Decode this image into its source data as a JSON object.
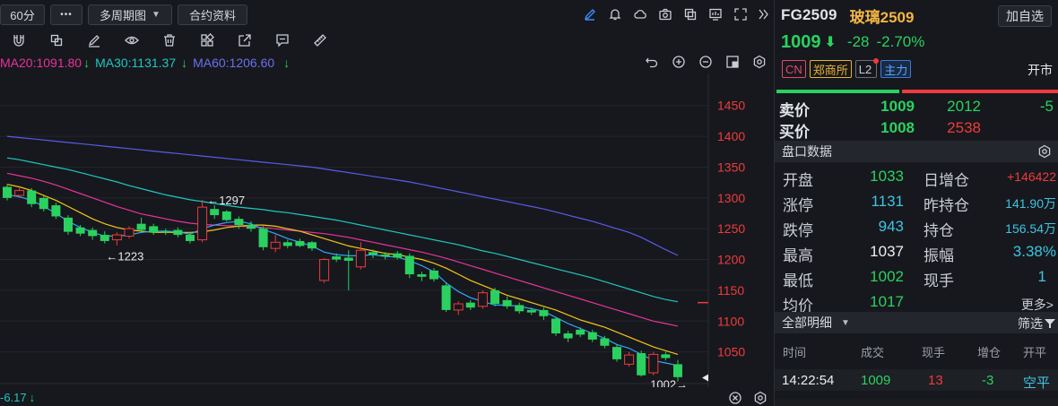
{
  "toolbar": {
    "period": "60分",
    "more_label": "•••",
    "multi_period": "多周期图",
    "contract_info": "合约资料",
    "right_icons": [
      "pen-icon",
      "bell-icon",
      "cloud-icon",
      "camera-icon",
      "copy-icon",
      "monitor-icon",
      "fullscreen-icon",
      "double-chevron-right-icon"
    ]
  },
  "drawing_tools": [
    "magnet-icon",
    "layers-icon",
    "pencil-icon",
    "eye-icon",
    "trash-icon",
    "grid-add-icon",
    "share-icon",
    "comment-icon",
    "ruler-icon"
  ],
  "ma": {
    "ma20": "MA20:1091.80",
    "ma30": "MA30:1131.37",
    "ma60": "MA60:1206.60",
    "arrow": "↓",
    "colors": {
      "ma5": "#2ea8ff",
      "ma10": "#f5c518",
      "ma20": "#e8339a",
      "ma30": "#1fc7c0",
      "ma60": "#5a5be8"
    }
  },
  "chart_controls": [
    "undo-icon",
    "zoom-in-icon",
    "zoom-out-icon",
    "layout-icon",
    "settings-icon"
  ],
  "chart_data": {
    "type": "candlestick",
    "y_ticks": [
      "1450",
      "1400",
      "1350",
      "1300",
      "1250",
      "1200",
      "1150",
      "1100",
      "1050"
    ],
    "ylim": [
      1002,
      1480
    ],
    "annotations": [
      {
        "text": "←1297",
        "x_index": 17,
        "price": 1297
      },
      {
        "text": "←1223",
        "x_index": 9,
        "price": 1223
      },
      {
        "text": "1002→",
        "x_index": 57,
        "price": 1002
      }
    ],
    "candles": [
      {
        "o": 1318,
        "c": 1300,
        "h": 1322,
        "l": 1296
      },
      {
        "o": 1304,
        "c": 1312,
        "h": 1316,
        "l": 1300
      },
      {
        "o": 1312,
        "c": 1290,
        "h": 1316,
        "l": 1285
      },
      {
        "o": 1300,
        "c": 1282,
        "h": 1304,
        "l": 1278
      },
      {
        "o": 1288,
        "c": 1270,
        "h": 1292,
        "l": 1266
      },
      {
        "o": 1268,
        "c": 1245,
        "h": 1272,
        "l": 1240
      },
      {
        "o": 1252,
        "c": 1242,
        "h": 1256,
        "l": 1238
      },
      {
        "o": 1248,
        "c": 1238,
        "h": 1252,
        "l": 1232
      },
      {
        "o": 1240,
        "c": 1230,
        "h": 1246,
        "l": 1226
      },
      {
        "o": 1232,
        "c": 1240,
        "h": 1244,
        "l": 1223
      },
      {
        "o": 1238,
        "c": 1250,
        "h": 1254,
        "l": 1234
      },
      {
        "o": 1258,
        "c": 1248,
        "h": 1268,
        "l": 1244
      },
      {
        "o": 1254,
        "c": 1244,
        "h": 1258,
        "l": 1240
      },
      {
        "o": 1246,
        "c": 1244,
        "h": 1250,
        "l": 1240
      },
      {
        "o": 1248,
        "c": 1240,
        "h": 1252,
        "l": 1236
      },
      {
        "o": 1240,
        "c": 1230,
        "h": 1244,
        "l": 1226
      },
      {
        "o": 1232,
        "c": 1285,
        "h": 1297,
        "l": 1228
      },
      {
        "o": 1282,
        "c": 1272,
        "h": 1288,
        "l": 1266
      },
      {
        "o": 1278,
        "c": 1264,
        "h": 1280,
        "l": 1262
      },
      {
        "o": 1266,
        "c": 1256,
        "h": 1270,
        "l": 1250
      },
      {
        "o": 1256,
        "c": 1250,
        "h": 1262,
        "l": 1245
      },
      {
        "o": 1250,
        "c": 1220,
        "h": 1254,
        "l": 1215
      },
      {
        "o": 1218,
        "c": 1228,
        "h": 1240,
        "l": 1212
      },
      {
        "o": 1228,
        "c": 1222,
        "h": 1232,
        "l": 1218
      },
      {
        "o": 1230,
        "c": 1222,
        "h": 1234,
        "l": 1220
      },
      {
        "o": 1228,
        "c": 1218,
        "h": 1230,
        "l": 1214
      },
      {
        "o": 1166,
        "c": 1200,
        "h": 1202,
        "l": 1162
      },
      {
        "o": 1205,
        "c": 1200,
        "h": 1210,
        "l": 1196
      },
      {
        "o": 1203,
        "c": 1198,
        "h": 1215,
        "l": 1150
      },
      {
        "o": 1188,
        "c": 1215,
        "h": 1228,
        "l": 1184
      },
      {
        "o": 1212,
        "c": 1208,
        "h": 1216,
        "l": 1202
      },
      {
        "o": 1208,
        "c": 1205,
        "h": 1212,
        "l": 1200
      },
      {
        "o": 1210,
        "c": 1203,
        "h": 1214,
        "l": 1200
      },
      {
        "o": 1206,
        "c": 1176,
        "h": 1210,
        "l": 1170
      },
      {
        "o": 1176,
        "c": 1172,
        "h": 1180,
        "l": 1165
      },
      {
        "o": 1182,
        "c": 1168,
        "h": 1186,
        "l": 1164
      },
      {
        "o": 1158,
        "c": 1118,
        "h": 1162,
        "l": 1115
      },
      {
        "o": 1118,
        "c": 1128,
        "h": 1132,
        "l": 1110
      },
      {
        "o": 1130,
        "c": 1122,
        "h": 1134,
        "l": 1118
      },
      {
        "o": 1124,
        "c": 1146,
        "h": 1150,
        "l": 1120
      },
      {
        "o": 1150,
        "c": 1128,
        "h": 1154,
        "l": 1124
      },
      {
        "o": 1134,
        "c": 1124,
        "h": 1140,
        "l": 1120
      },
      {
        "o": 1126,
        "c": 1116,
        "h": 1130,
        "l": 1112
      },
      {
        "o": 1118,
        "c": 1114,
        "h": 1122,
        "l": 1110
      },
      {
        "o": 1118,
        "c": 1108,
        "h": 1122,
        "l": 1102
      },
      {
        "o": 1104,
        "c": 1080,
        "h": 1106,
        "l": 1076
      },
      {
        "o": 1080,
        "c": 1072,
        "h": 1084,
        "l": 1066
      },
      {
        "o": 1086,
        "c": 1078,
        "h": 1090,
        "l": 1074
      },
      {
        "o": 1082,
        "c": 1070,
        "h": 1086,
        "l": 1066
      },
      {
        "o": 1072,
        "c": 1060,
        "h": 1076,
        "l": 1056
      },
      {
        "o": 1058,
        "c": 1038,
        "h": 1062,
        "l": 1034
      },
      {
        "o": 1030,
        "c": 1045,
        "h": 1050,
        "l": 1026
      },
      {
        "o": 1048,
        "c": 1012,
        "h": 1052,
        "l": 1010
      },
      {
        "o": 1016,
        "c": 1046,
        "h": 1050,
        "l": 1012
      },
      {
        "o": 1046,
        "c": 1040,
        "h": 1050,
        "l": 1036
      },
      {
        "o": 1030,
        "c": 1009,
        "h": 1037,
        "l": 1002
      }
    ],
    "ma5": [
      1305,
      1302,
      1296,
      1286,
      1275,
      1262,
      1252,
      1244,
      1238,
      1238,
      1240,
      1244,
      1246,
      1246,
      1245,
      1241,
      1250,
      1256,
      1260,
      1262,
      1258,
      1249,
      1242,
      1234,
      1228,
      1222,
      1212,
      1208,
      1206,
      1206,
      1208,
      1205,
      1204,
      1198,
      1190,
      1180,
      1162,
      1148,
      1138,
      1132,
      1126,
      1126,
      1124,
      1120,
      1116,
      1106,
      1096,
      1088,
      1080,
      1072,
      1062,
      1056,
      1046,
      1036,
      1032,
      1028
    ],
    "ma10": [
      1322,
      1318,
      1312,
      1304,
      1296,
      1286,
      1276,
      1266,
      1258,
      1252,
      1248,
      1246,
      1244,
      1244,
      1244,
      1244,
      1245,
      1248,
      1252,
      1254,
      1256,
      1256,
      1254,
      1250,
      1246,
      1240,
      1234,
      1228,
      1222,
      1218,
      1214,
      1210,
      1208,
      1204,
      1200,
      1194,
      1186,
      1176,
      1166,
      1158,
      1150,
      1142,
      1136,
      1130,
      1124,
      1118,
      1110,
      1102,
      1096,
      1090,
      1082,
      1074,
      1066,
      1058,
      1052,
      1046
    ],
    "ma20": [
      1340,
      1336,
      1332,
      1327,
      1321,
      1314,
      1307,
      1300,
      1293,
      1286,
      1280,
      1274,
      1270,
      1266,
      1262,
      1259,
      1257,
      1256,
      1255,
      1254,
      1253,
      1252,
      1250,
      1248,
      1246,
      1244,
      1242,
      1239,
      1236,
      1232,
      1228,
      1224,
      1220,
      1216,
      1212,
      1207,
      1202,
      1196,
      1190,
      1184,
      1178,
      1172,
      1166,
      1160,
      1154,
      1148,
      1142,
      1136,
      1130,
      1124,
      1118,
      1112,
      1106,
      1100,
      1096,
      1091.8
    ],
    "ma30": [
      1365,
      1362,
      1358,
      1354,
      1350,
      1346,
      1341,
      1336,
      1331,
      1326,
      1320,
      1315,
      1310,
      1305,
      1301,
      1297,
      1294,
      1291,
      1288,
      1285,
      1283,
      1281,
      1278,
      1276,
      1273,
      1270,
      1267,
      1264,
      1260,
      1256,
      1252,
      1248,
      1244,
      1240,
      1236,
      1232,
      1228,
      1224,
      1219,
      1214,
      1210,
      1205,
      1200,
      1195,
      1190,
      1185,
      1180,
      1175,
      1170,
      1164,
      1158,
      1152,
      1146,
      1140,
      1135,
      1131.37
    ],
    "ma60": [
      1400,
      1398,
      1396,
      1394,
      1392,
      1390,
      1388,
      1386,
      1384,
      1382,
      1380,
      1378,
      1376,
      1374,
      1372,
      1370,
      1368,
      1366,
      1364,
      1362,
      1360,
      1358,
      1356,
      1354,
      1352,
      1350,
      1347,
      1344,
      1341,
      1338,
      1335,
      1332,
      1329,
      1326,
      1322,
      1318,
      1314,
      1310,
      1306,
      1302,
      1298,
      1294,
      1290,
      1286,
      1282,
      1277,
      1272,
      1267,
      1262,
      1256,
      1250,
      1244,
      1236,
      1226,
      1216,
      1206.6
    ],
    "last_marker_price": 1130,
    "colors": {
      "up": "#ef3b3b",
      "down": "#2bd15f",
      "axis": "#ef3b3b",
      "grid": "#23262c"
    }
  },
  "bottom": {
    "indicator": "-6.17",
    "arrow": "↓"
  },
  "bottom_controls": [
    "close-circle-icon",
    "settings-icon"
  ],
  "quote": {
    "code": "FG2509",
    "name": "玻璃2509",
    "add_favorite": "加自选",
    "price": "1009",
    "price_arrow": "⬇",
    "change": "-28",
    "change_pct": "-2.70%",
    "tags": {
      "cn": "CN",
      "exchange": "郑商所",
      "level": "L2",
      "main": "主力"
    },
    "status": "开市",
    "ratio": {
      "green": 0.44,
      "red": 0.56
    }
  },
  "orderbook": {
    "ask": {
      "label": "卖价",
      "price": "1009",
      "volume": "2012",
      "change": "-5"
    },
    "bid": {
      "label": "买价",
      "price": "1008",
      "volume": "2538"
    }
  },
  "panel": {
    "title": "盘口数据",
    "rows": [
      {
        "k1": "开盘",
        "v1": "1033",
        "k2": "日增仓",
        "v2": "+146422"
      },
      {
        "k1": "涨停",
        "v1": "1131",
        "k2": "昨持仓",
        "v2": "141.90万"
      },
      {
        "k1": "跌停",
        "v1": "943",
        "k2": "持仓",
        "v2": "156.54万"
      },
      {
        "k1": "最高",
        "v1": "1037",
        "k2": "振幅",
        "v2": "3.38%"
      },
      {
        "k1": "最低",
        "v1": "1002",
        "k2": "现手",
        "v2": "1"
      },
      {
        "k1": "均价",
        "v1": "1017",
        "k2": "",
        "v2": ""
      }
    ],
    "more": "更多>"
  },
  "details": {
    "title": "全部明细",
    "filter": "筛选",
    "columns": [
      "时间",
      "成交",
      "现手",
      "增仓",
      "开平"
    ],
    "row": {
      "time": "14:22:54",
      "price": "1009",
      "volume": "13",
      "oi_change": "-3",
      "type": "空平"
    }
  }
}
